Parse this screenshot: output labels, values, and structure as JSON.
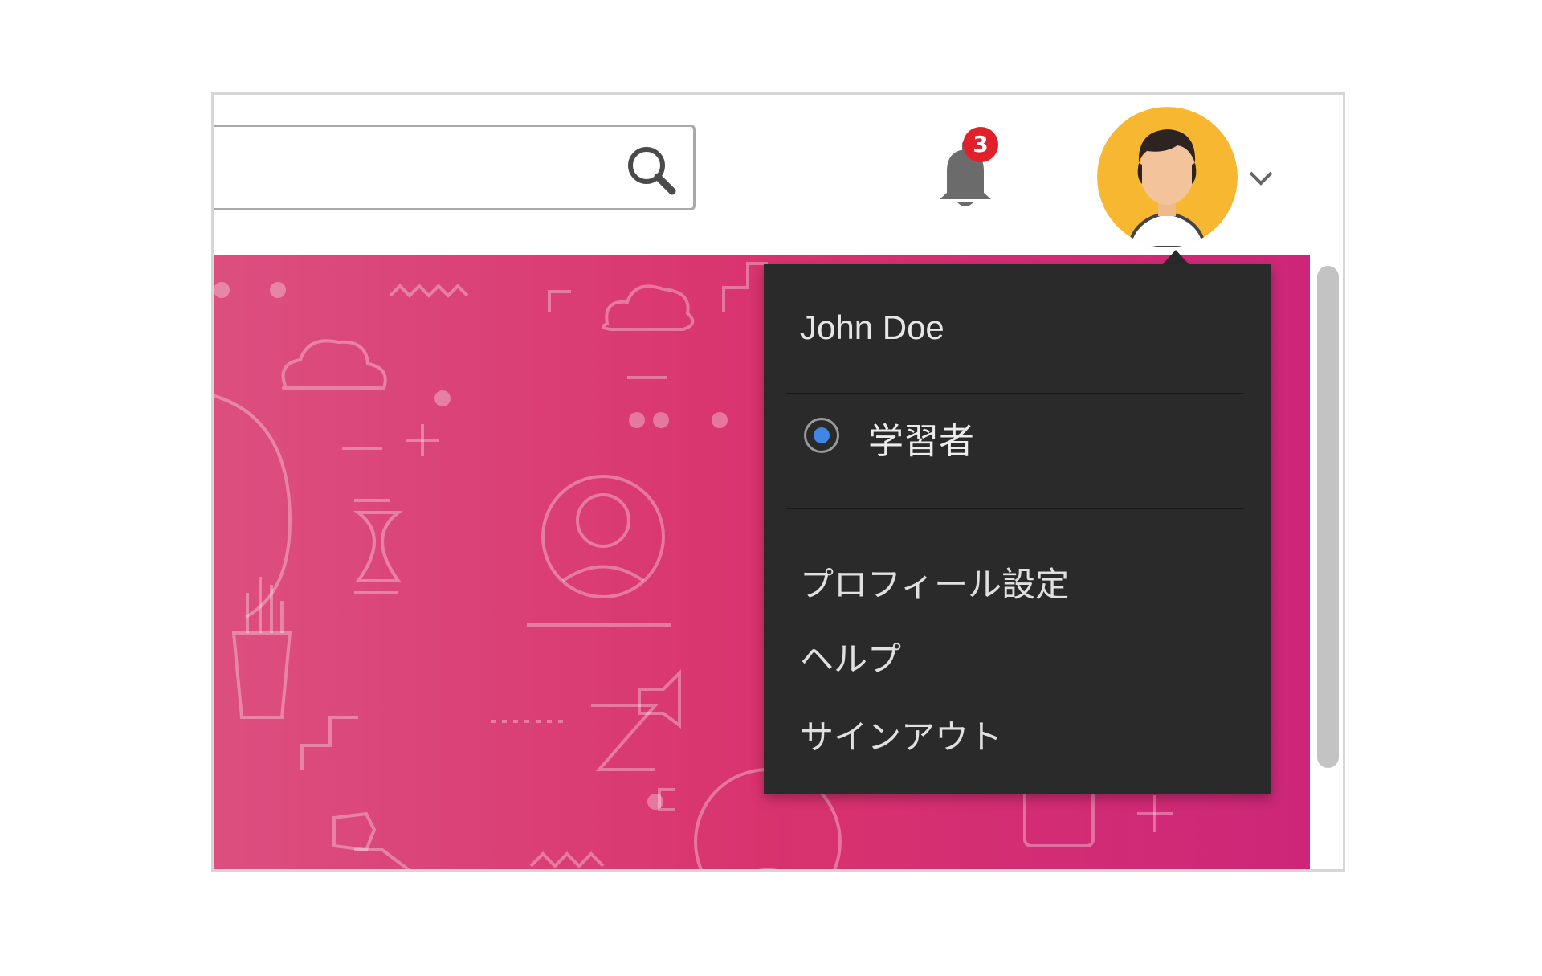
{
  "header": {
    "search": {
      "placeholder": "",
      "value": "",
      "icon": "search-icon"
    },
    "notifications": {
      "icon": "bell-icon",
      "count": "3",
      "badge_color": "#e0202a"
    },
    "avatar": {
      "icon": "user-avatar",
      "background": "#f7b731"
    },
    "chevron_icon": "chevron-down-icon"
  },
  "banner": {
    "gradient_start": "#dc4f7f",
    "gradient_end": "#cd2679"
  },
  "dropdown": {
    "user_name": "John Doe",
    "role": {
      "label": "学習者",
      "selected": true,
      "radio_color": "#3f86e5"
    },
    "items": [
      {
        "label": "プロフィール設定"
      },
      {
        "label": "ヘルプ"
      },
      {
        "label": "サインアウト"
      }
    ],
    "background": "#2a2a2a"
  }
}
